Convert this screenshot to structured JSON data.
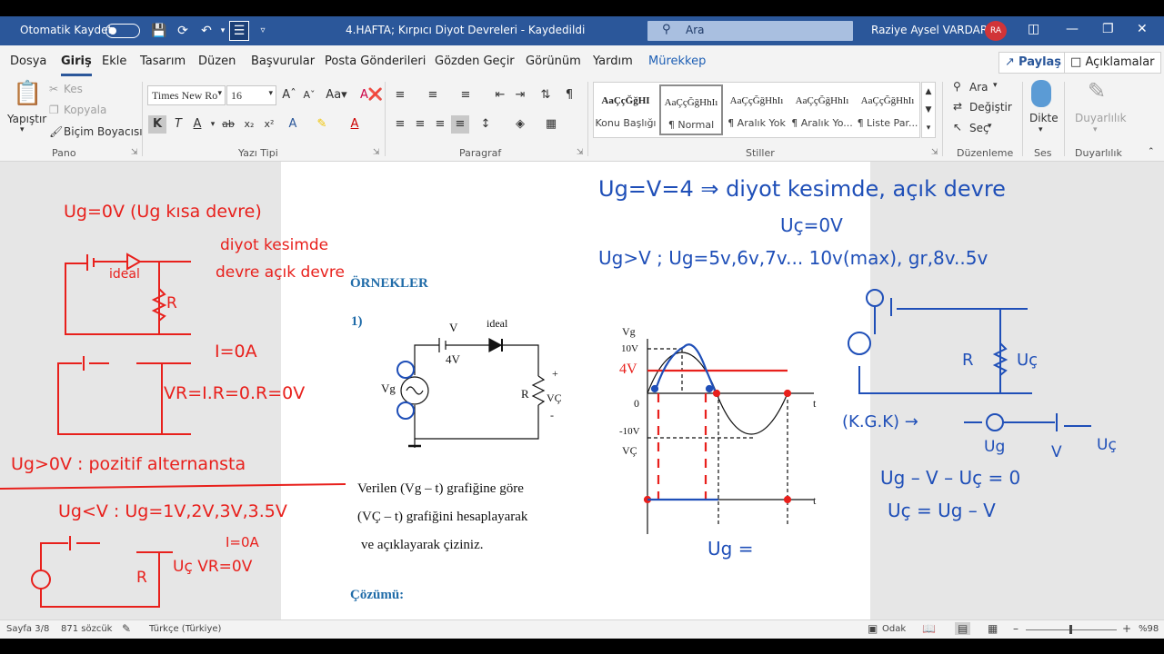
{
  "titlebar": {
    "autosave_label": "Otomatik Kaydet",
    "document_title": "4.HAFTA; Kırpıcı Diyot Devreleri  -  Kaydedildi",
    "search_placeholder": "Ara",
    "user_name": "Raziye Aysel VARDAR",
    "user_initials": "RA"
  },
  "menu": {
    "tabs": [
      "Dosya",
      "Giriş",
      "Ekle",
      "Tasarım",
      "Düzen",
      "Başvurular",
      "Posta Gönderileri",
      "Gözden Geçir",
      "Görünüm",
      "Yardım",
      "Mürekkep"
    ],
    "active_tab": "Giriş",
    "share_label": "Paylaş",
    "comments_label": "Açıklamalar"
  },
  "ribbon": {
    "clipboard": {
      "paste": "Yapıştır",
      "cut": "Kes",
      "copy": "Kopyala",
      "format_painter": "Biçim Boyacısı",
      "label": "Pano"
    },
    "font": {
      "name": "Times New Ro",
      "size": "16",
      "label": "Yazı Tipi"
    },
    "paragraph": {
      "label": "Paragraf"
    },
    "styles": {
      "items": [
        {
          "sample": "AaÇçĞğHI",
          "name": "Konu Başlığı"
        },
        {
          "sample": "AaÇçĞğHhIı",
          "name": "¶ Normal"
        },
        {
          "sample": "AaÇçĞğHhIı",
          "name": "¶ Aralık Yok"
        },
        {
          "sample": "AaÇçĞğHhIı",
          "name": "¶ Aralık Yo..."
        },
        {
          "sample": "AaÇçĞğHhIı",
          "name": "¶ Liste Par..."
        }
      ],
      "label": "Stiller"
    },
    "editing": {
      "find": "Ara",
      "replace": "Değiştir",
      "select": "Seç",
      "label": "Düzenleme"
    },
    "voice": {
      "dictate": "Dikte",
      "label": "Ses"
    },
    "sensitivity": {
      "button": "Duyarlılık",
      "label": "Duyarlılık"
    }
  },
  "document": {
    "heading": "ÖRNEKLER",
    "example_number": "1)",
    "circuit": {
      "source_v": "V",
      "source_value": "4V",
      "diode_label": "ideal",
      "resistor": "R",
      "vg": "Vg",
      "vc": "VÇ",
      "plus": "+",
      "minus": "-"
    },
    "graph": {
      "vg_axis": "Vg",
      "vc_axis": "VÇ",
      "t": "t",
      "y_max": "10V",
      "y_min": "-10V",
      "zero": "0",
      "level": "4V"
    },
    "question_lines": [
      "Verilen (Vg – t) grafiğine göre",
      "(VÇ – t) grafiğini hesaplayarak",
      "ve açıklayarak çiziniz."
    ],
    "solution_label": "Çözümü:"
  },
  "handwriting": {
    "left": [
      "Ug=0V (Ug kısa devre)",
      "diyot kesimde",
      "devre açık devre",
      "ideal",
      "R",
      "I=0A",
      "VR=I.R=0.R=0V",
      "Ug>0V : pozitif alternansta",
      "Ug<V : Ug=1V,2V,3V,3.5V",
      "I=0A",
      "R",
      "Uç  VR=0V"
    ],
    "right": [
      "Ug=V=4 ⇒ diyot kesimde, açık devre",
      "Uç=0V",
      "Ug>V ; Ug=5v,6v,7v... 10v(max), gr,8v..5v",
      "R",
      "Uç",
      "(K.G.K) →",
      "Ug",
      "V",
      "Uç",
      "Ug – V – Uç = 0",
      "Uç = Ug – V",
      "Ug ="
    ]
  },
  "statusbar": {
    "page": "Sayfa 3/8",
    "words": "871 sözcük",
    "language": "Türkçe (Türkiye)",
    "focus": "Odak",
    "zoom": "%98"
  },
  "colors": {
    "accent": "#2b579a",
    "ink_red": "#e8201c",
    "ink_blue": "#1f4fb8",
    "heading_blue": "#1f6ba8"
  }
}
